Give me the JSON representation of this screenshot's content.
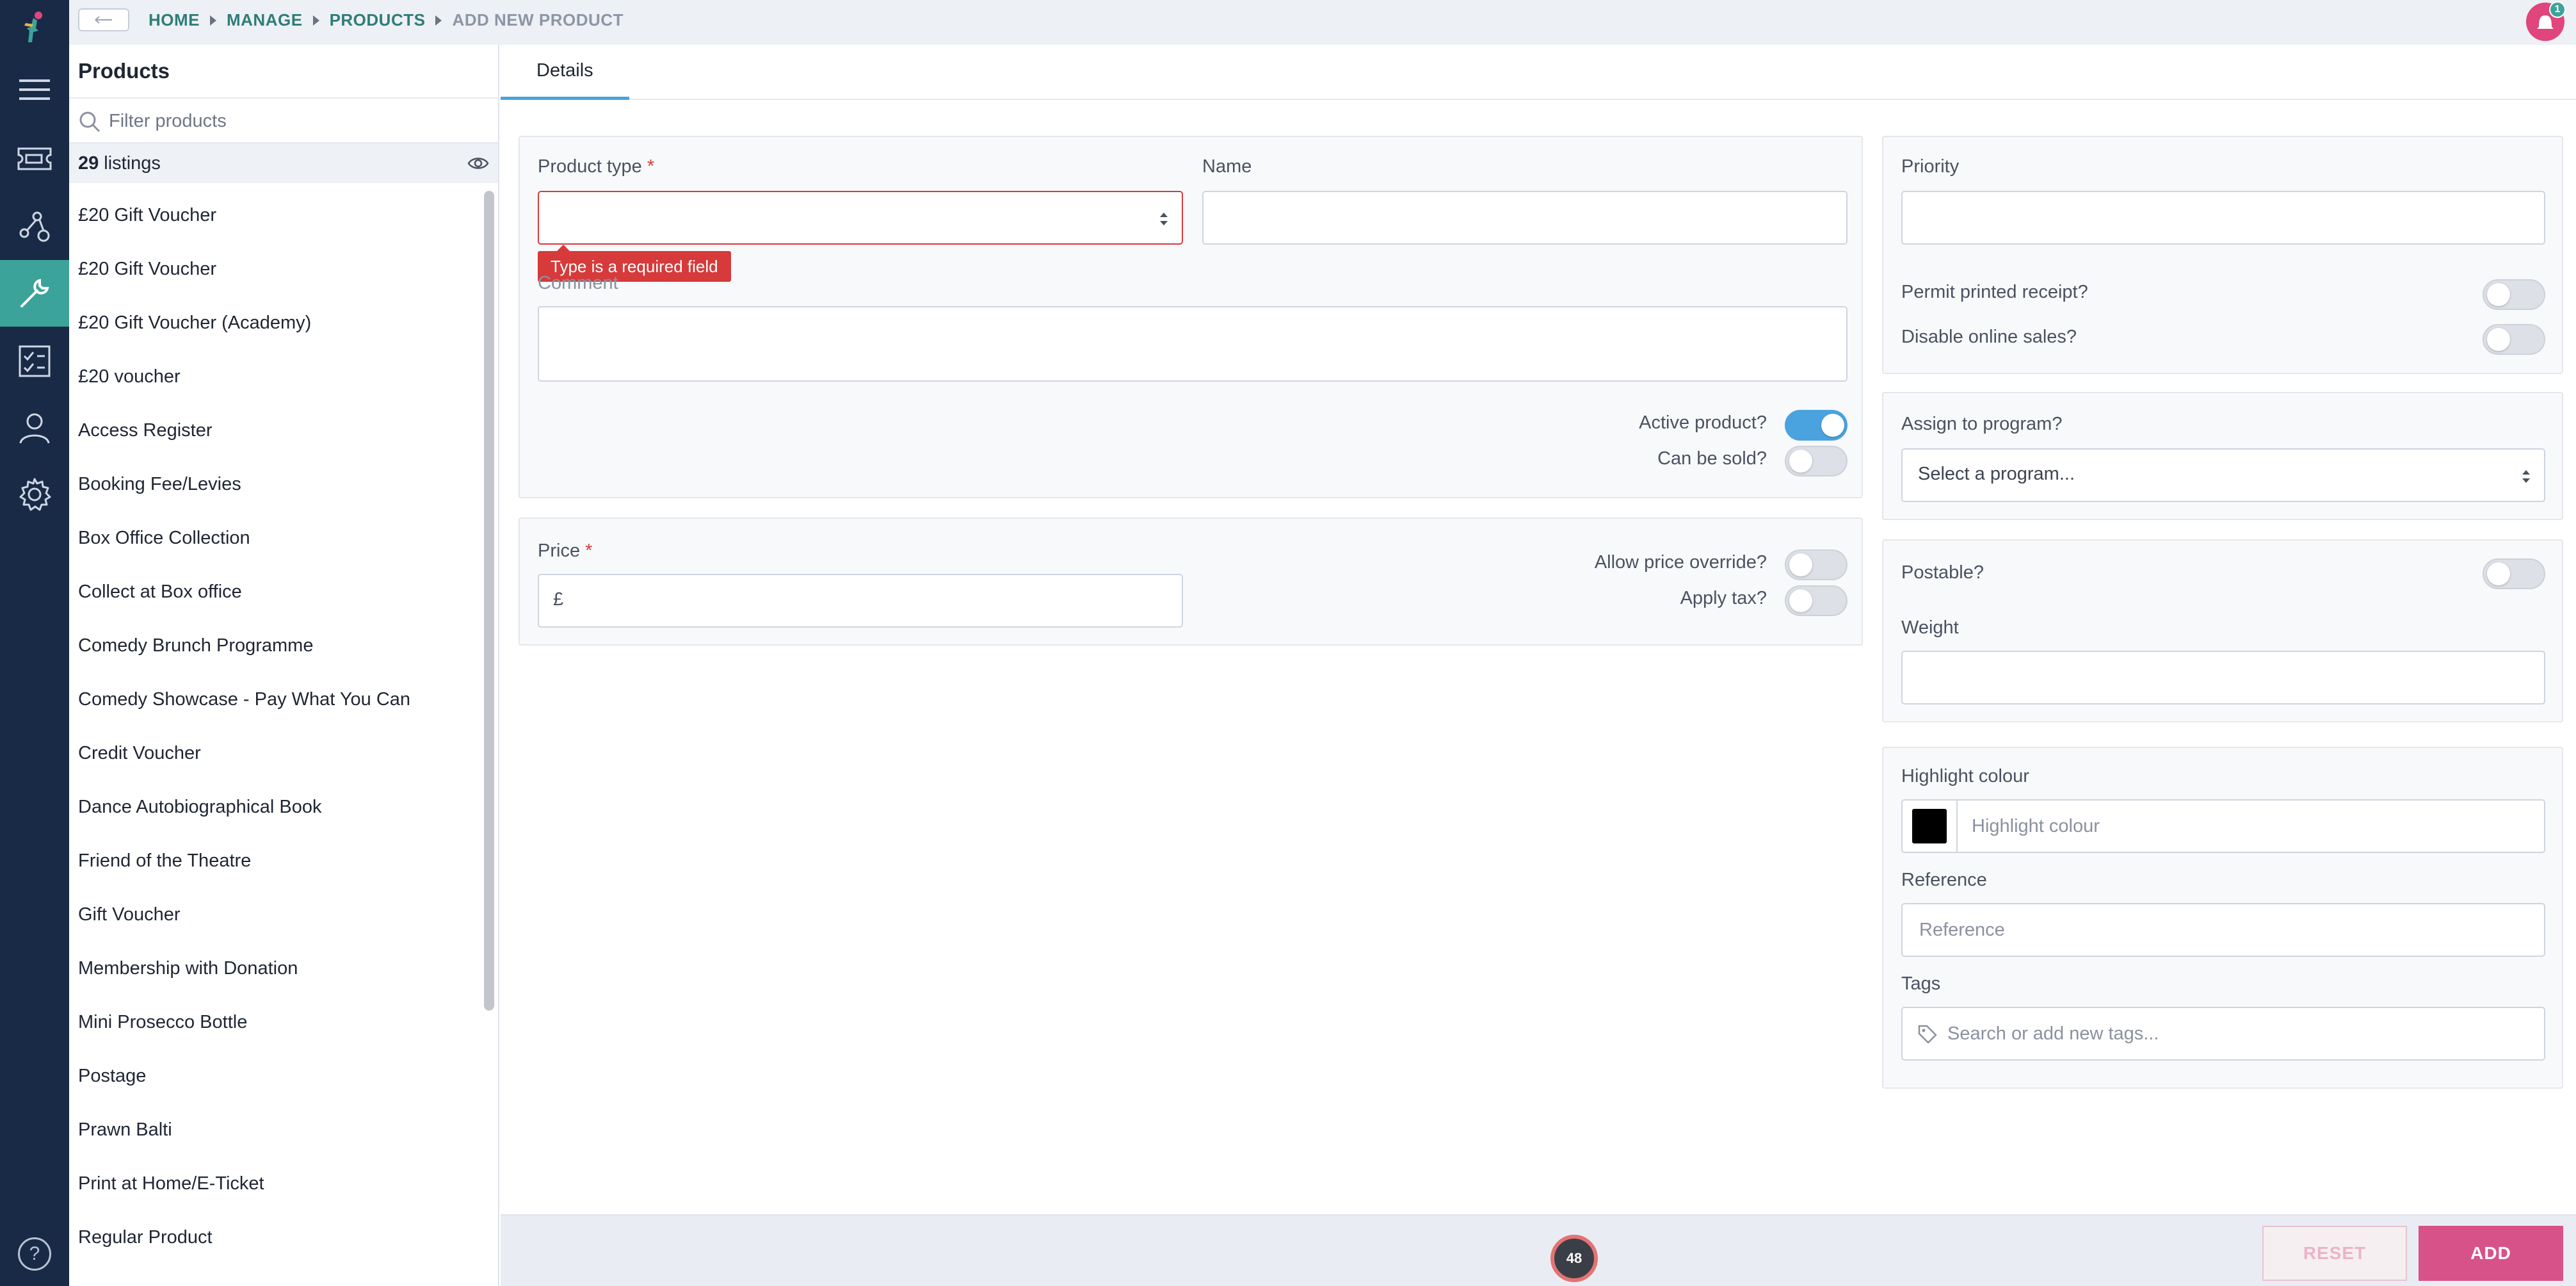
{
  "breadcrumbs": [
    "HOME",
    "MANAGE",
    "PRODUCTS",
    "ADD NEW PRODUCT"
  ],
  "notifications": {
    "count": "1",
    "color": "#e0457b"
  },
  "nav": [
    "menu-icon",
    "ticket-icon",
    "reports-icon",
    "tools-icon",
    "checklist-icon",
    "user-icon",
    "gear-icon"
  ],
  "sidebar": {
    "title": "Products",
    "filter_placeholder": "Filter products",
    "count": "29",
    "count_label": "listings",
    "items": [
      "£20 Gift Voucher",
      "£20 Gift Voucher",
      "£20 Gift Voucher (Academy)",
      "£20 voucher",
      "Access Register",
      "Booking Fee/Levies",
      "Box Office Collection",
      "Collect at Box office",
      "Comedy Brunch Programme",
      "Comedy Showcase - Pay What You Can",
      "Credit Voucher",
      "Dance Autobiographical Book",
      "Friend of the Theatre",
      "Gift Voucher",
      "Membership with Donation",
      "Mini Prosecco Bottle",
      "Postage",
      "Prawn Balti",
      "Print at Home/E-Ticket",
      "Regular Product"
    ]
  },
  "tabs": {
    "details": "Details"
  },
  "form": {
    "product_type_label": "Product type",
    "required_mark": "*",
    "product_type_error": "Type is a required field",
    "name_label": "Name",
    "comment_label": "Comment",
    "active_label": "Active product?",
    "can_be_sold_label": "Can be sold?",
    "price_label": "Price",
    "price_prefix": "£",
    "allow_override_label": "Allow price override?",
    "apply_tax_label": "Apply tax?",
    "priority_label": "Priority",
    "permit_receipt_label": "Permit printed receipt?",
    "disable_online_label": "Disable online sales?",
    "assign_program_label": "Assign to program?",
    "program_select_value": "Select a program...",
    "postable_label": "Postable?",
    "weight_label": "Weight",
    "highlight_label": "Highlight colour",
    "highlight_placeholder": "Highlight colour",
    "highlight_swatch": "#000000",
    "reference_label": "Reference",
    "reference_placeholder": "Reference",
    "tags_label": "Tags",
    "tags_placeholder": "Search or add new tags..."
  },
  "footer": {
    "spinner_value": "48",
    "reset_label": "RESET",
    "add_label": "ADD"
  },
  "help": "?"
}
